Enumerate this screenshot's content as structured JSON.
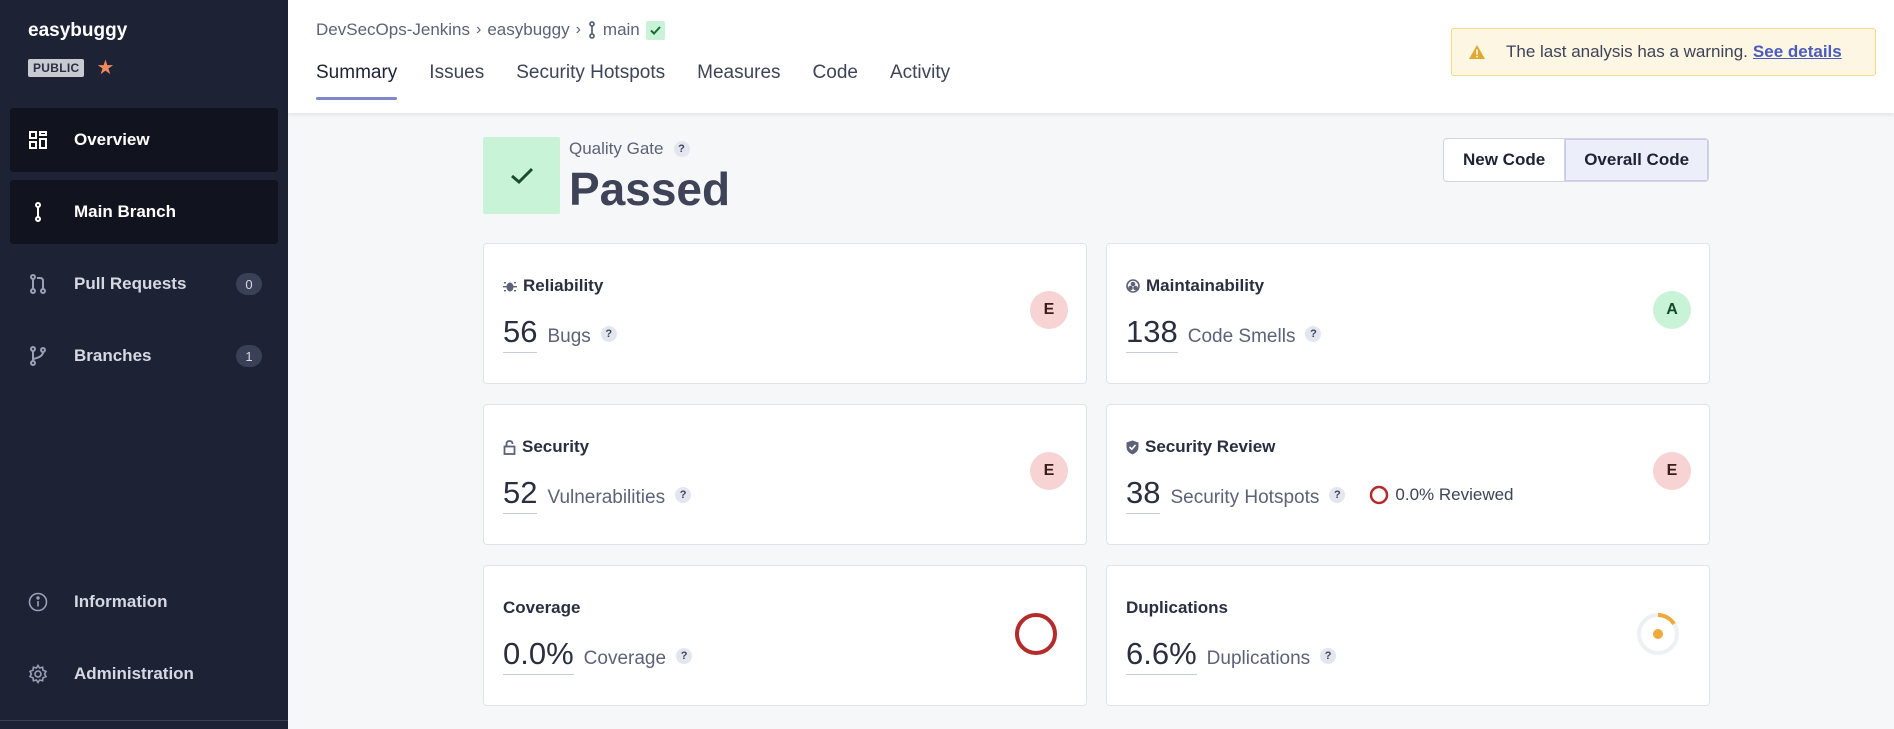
{
  "sidebar": {
    "project_name": "easybuggy",
    "visibility_badge": "PUBLIC",
    "items": [
      {
        "label": "Overview"
      },
      {
        "label": "Main Branch"
      },
      {
        "label": "Pull Requests",
        "count": "0"
      },
      {
        "label": "Branches",
        "count": "1"
      },
      {
        "label": "Information"
      },
      {
        "label": "Administration"
      }
    ]
  },
  "header": {
    "breadcrumb": [
      "DevSecOps-Jenkins",
      "easybuggy",
      "main"
    ],
    "tabs": [
      "Summary",
      "Issues",
      "Security Hotspots",
      "Measures",
      "Code",
      "Activity"
    ],
    "warning": {
      "text": "The last analysis has a warning.",
      "link": "See details"
    }
  },
  "quality_gate": {
    "label": "Quality Gate",
    "status": "Passed"
  },
  "toggle": {
    "new_code": "New Code",
    "overall_code": "Overall Code",
    "selected": "Overall Code"
  },
  "cards": {
    "reliability": {
      "title": "Reliability",
      "value": "56",
      "label": "Bugs",
      "rating": "E"
    },
    "maintainability": {
      "title": "Maintainability",
      "value": "138",
      "label": "Code Smells",
      "rating": "A"
    },
    "security": {
      "title": "Security",
      "value": "52",
      "label": "Vulnerabilities",
      "rating": "E"
    },
    "security_review": {
      "title": "Security Review",
      "value": "38",
      "label": "Security Hotspots",
      "reviewed": "0.0% Reviewed",
      "rating": "E"
    },
    "coverage": {
      "title": "Coverage",
      "value": "0.0%",
      "label": "Coverage",
      "percent": 0
    },
    "duplications": {
      "title": "Duplications",
      "value": "6.6%",
      "label": "Duplications",
      "percent": 6.6
    }
  },
  "help_glyph": "?",
  "colors": {
    "sidebar_bg": "#1d2235",
    "passed_green": "#c9f3d6",
    "rating_e": "#f8d3d3",
    "rating_a": "#c9f3d6",
    "coverage_ring": "#b32b2b",
    "duplication_ring": "#f0a93b",
    "accent": "#4c5bbd"
  }
}
